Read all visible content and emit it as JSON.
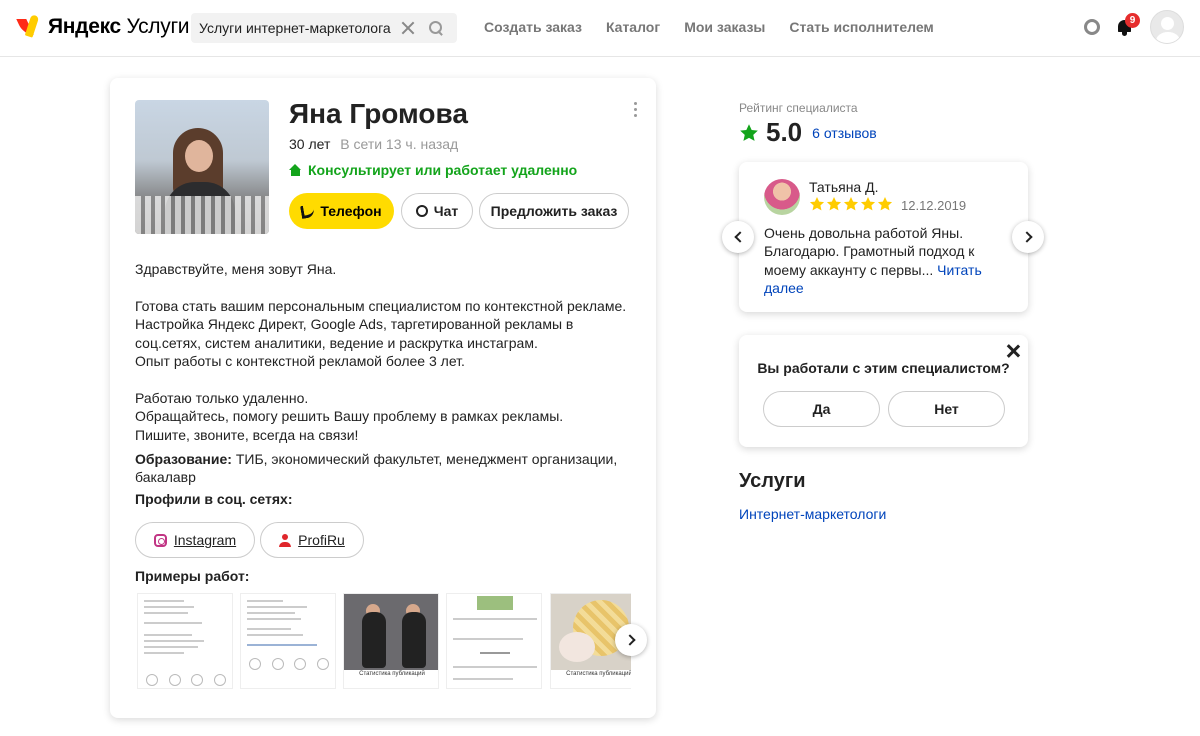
{
  "header": {
    "logo_brand": "Яндекс",
    "logo_product": "Услуги",
    "search_value": "Услуги интернет-маркетолога г",
    "nav": [
      "Создать заказ",
      "Каталог",
      "Мои заказы",
      "Стать исполнителем"
    ],
    "notifications_count": "9"
  },
  "profile": {
    "name": "Яна Громова",
    "age": "30 лет",
    "online": "В сети 13 ч. назад",
    "remote": "Консультирует или работает удаленно",
    "btn_phone": "Телефон",
    "btn_chat": "Чат",
    "btn_offer": "Предложить заказ",
    "about": [
      "Здравствуйте, меня зовут Яна.",
      "Готова стать вашим персональным специалистом по контекстной рекламе. Настройка Яндекс Директ, Google Ads, таргетированной рекламы в соц.сетях, систем аналитики, ведение и раскрутка инстаграм.\nОпыт работы с контекстной рекламой более 3 лет.",
      "Работаю только удаленно.\nОбращайтесь, помогу решить Вашу проблему в рамках рекламы.\nПишите, звоните, всегда на связи!"
    ],
    "education_label": "Образование:",
    "education_value": "ТИБ, экономический факультет, менеджмент организации, бакалавр",
    "social_title": "Профили в соц. сетях:",
    "social": [
      "Instagram",
      "ProfiRu"
    ],
    "works_title": "Примеры работ:",
    "works_caption": "Статистика публикаций"
  },
  "rating": {
    "label": "Рейтинг специалиста",
    "value": "5.0",
    "reviews_link": "6 отзывов",
    "star_color": "#13a41b"
  },
  "review": {
    "author": "Татьяна Д.",
    "stars": 5,
    "date": "12.12.2019",
    "text": "Очень довольна работой Яны. Благодарю. Грамотный подход к моему аккаунту с первы... ",
    "more": "Читать далее"
  },
  "ask": {
    "question": "Вы работали с этим специалистом?",
    "yes": "Да",
    "no": "Нет"
  },
  "services": {
    "title": "Услуги",
    "link": "Интернет-маркетологи"
  },
  "colors": {
    "accent_yellow": "#ffdb00",
    "link_blue": "#0044bb",
    "green": "#13a41b",
    "star_yellow": "#ffcc00"
  }
}
